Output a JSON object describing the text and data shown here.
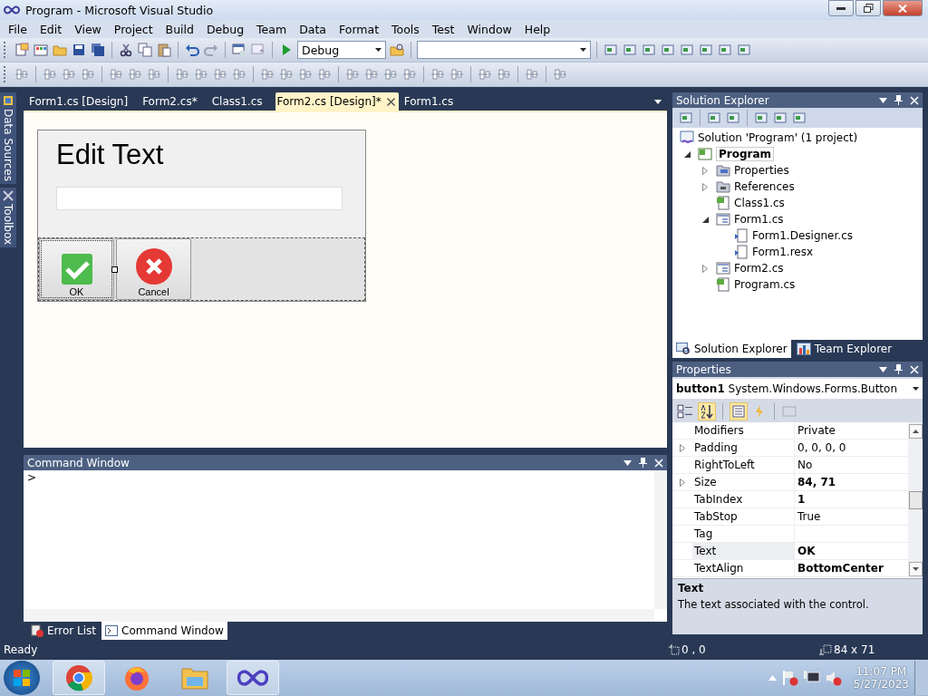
{
  "window": {
    "title": "Program - Microsoft Visual Studio"
  },
  "menu": [
    "File",
    "Edit",
    "View",
    "Project",
    "Build",
    "Debug",
    "Team",
    "Data",
    "Format",
    "Tools",
    "Test",
    "Window",
    "Help"
  ],
  "toolbar": {
    "configuration": "Debug"
  },
  "side_tabs": [
    "Data Sources",
    "Toolbox"
  ],
  "document_tabs": [
    {
      "label": "Form1.cs [Design]",
      "selected": false
    },
    {
      "label": "Form2.cs*",
      "selected": false
    },
    {
      "label": "Class1.cs",
      "selected": false
    },
    {
      "label": "Form2.cs [Design]*",
      "selected": true
    },
    {
      "label": "Form1.cs",
      "selected": false
    }
  ],
  "designer": {
    "form_title": "Edit Text",
    "buttons": [
      {
        "label": "OK",
        "kind": "ok",
        "selected": true
      },
      {
        "label": "Cancel",
        "kind": "cancel",
        "selected": false
      }
    ]
  },
  "command_window": {
    "title": "Command Window",
    "prompt": ">"
  },
  "bottom_tabs": [
    {
      "label": "Error List",
      "kind": "errors",
      "selected": false
    },
    {
      "label": "Command Window",
      "kind": "command",
      "selected": true
    }
  ],
  "solution_explorer": {
    "title": "Solution Explorer",
    "tree": {
      "label": "Solution 'Program' (1 project)",
      "kind": "solution",
      "children": [
        {
          "label": "Program",
          "kind": "project",
          "expanded": true,
          "selected": true,
          "children": [
            {
              "label": "Properties",
              "kind": "properties",
              "expanded": false
            },
            {
              "label": "References",
              "kind": "references",
              "expanded": false
            },
            {
              "label": "Class1.cs",
              "kind": "code"
            },
            {
              "label": "Form1.cs",
              "kind": "form",
              "expanded": true,
              "children": [
                {
                  "label": "Form1.Designer.cs",
                  "kind": "designer"
                },
                {
                  "label": "Form1.resx",
                  "kind": "designer"
                }
              ]
            },
            {
              "label": "Form2.cs",
              "kind": "form",
              "expanded": false
            },
            {
              "label": "Program.cs",
              "kind": "code"
            }
          ]
        }
      ]
    },
    "tabs": [
      {
        "label": "Solution Explorer",
        "kind": "solution",
        "selected": true
      },
      {
        "label": "Team Explorer",
        "kind": "team",
        "selected": false
      }
    ]
  },
  "properties": {
    "title": "Properties",
    "object_name": "button1",
    "object_type": "System.Windows.Forms.Button",
    "rows": [
      {
        "name": "Modifiers",
        "value": "Private",
        "modified": false,
        "selected": false
      },
      {
        "name": "Padding",
        "value": "0, 0, 0, 0",
        "expanded": false,
        "modified": false,
        "selected": false
      },
      {
        "name": "RightToLeft",
        "value": "No",
        "modified": false,
        "selected": false
      },
      {
        "name": "Size",
        "value": "84, 71",
        "expanded": false,
        "modified": true,
        "selected": false
      },
      {
        "name": "TabIndex",
        "value": "1",
        "modified": true,
        "selected": false
      },
      {
        "name": "TabStop",
        "value": "True",
        "modified": false,
        "selected": false
      },
      {
        "name": "Tag",
        "selected": false
      },
      {
        "name": "Text",
        "value": "OK",
        "modified": true,
        "selected": true
      },
      {
        "name": "TextAlign",
        "value": "BottomCenter",
        "modified": true,
        "selected": false
      }
    ],
    "description_title": "Text",
    "description": "The text associated with the control."
  },
  "status_bar": {
    "message": "Ready",
    "position": "0 , 0",
    "size": "84 x 71"
  },
  "taskbar": {
    "apps": [
      {
        "kind": "chrome",
        "running": true
      },
      {
        "kind": "firefox",
        "running": false
      },
      {
        "kind": "files",
        "running": false
      },
      {
        "kind": "studio",
        "running": true
      }
    ],
    "time": "11:07 PM",
    "date": "5/27/2023"
  }
}
